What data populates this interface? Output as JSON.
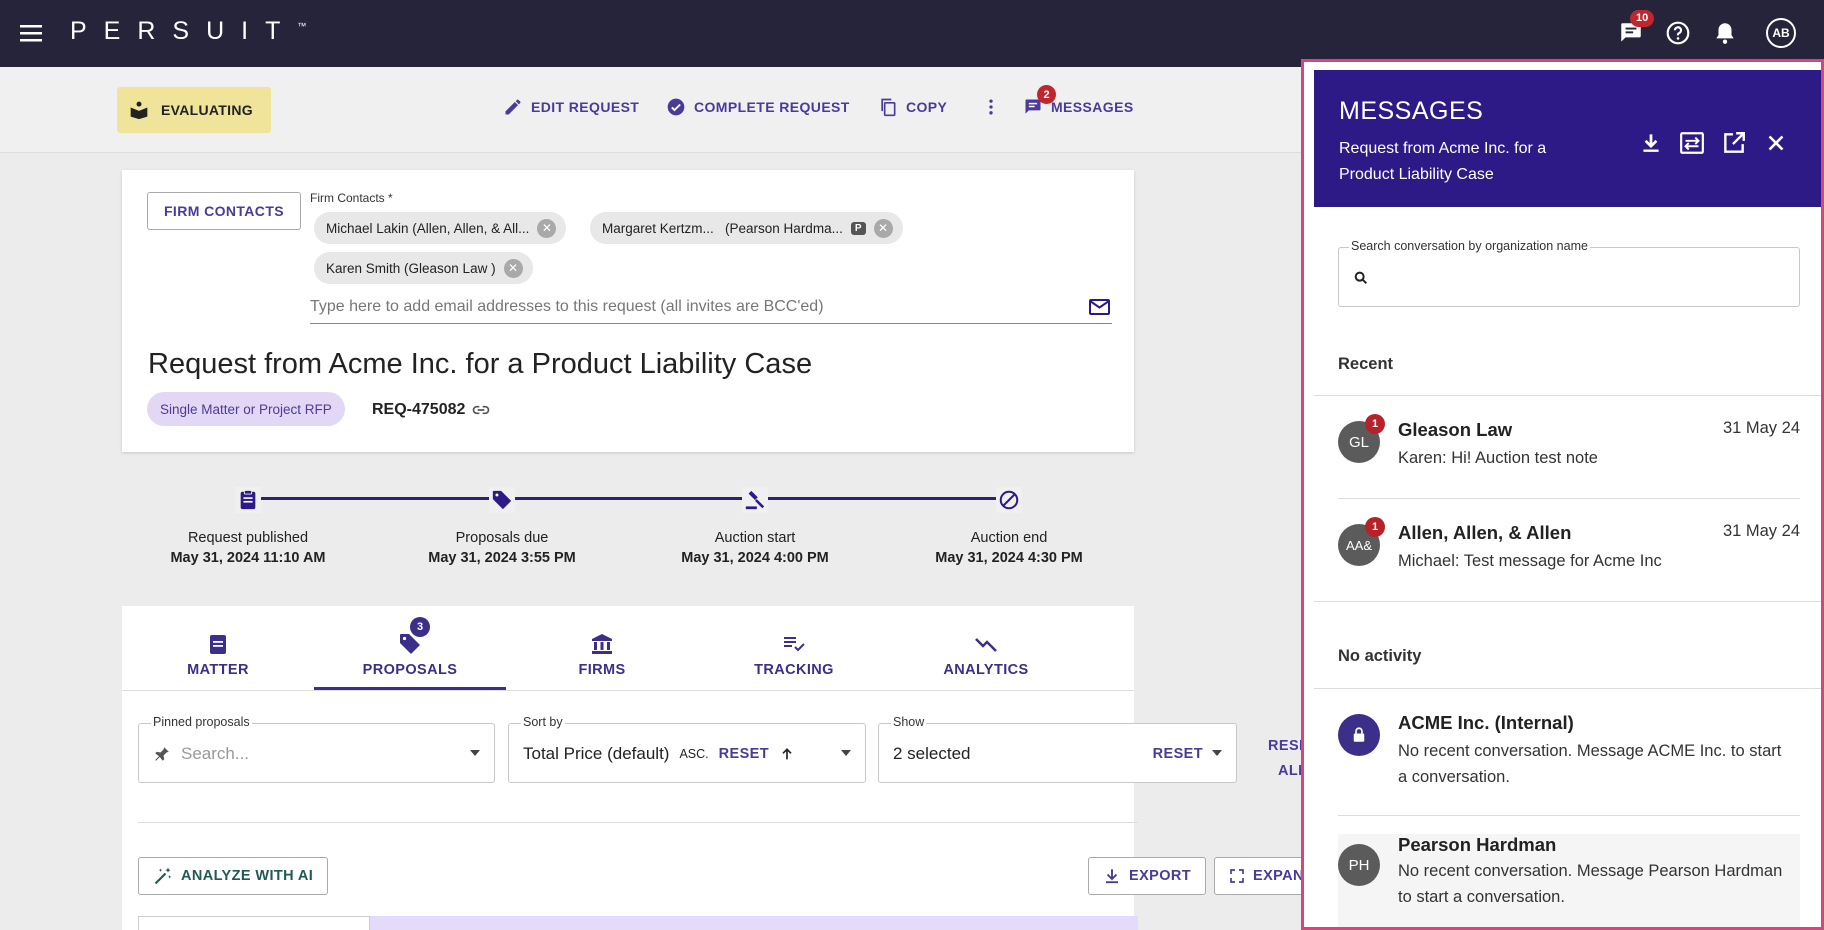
{
  "topbar": {
    "logo": "PERSUIT",
    "logo_tm": "™",
    "messages_badge": "10",
    "avatar": "AB"
  },
  "actionbar": {
    "status": "EVALUATING",
    "edit_request": "EDIT REQUEST",
    "complete_request": "COMPLETE REQUEST",
    "copy": "COPY",
    "messages": "MESSAGES",
    "messages_badge": "2"
  },
  "request_card": {
    "firm_contacts_button": "FIRM CONTACTS",
    "firm_contacts_label": "Firm Contacts *",
    "contacts": [
      {
        "label": "Michael Lakin (Allen, Allen, & All..."
      },
      {
        "label": "Margaret Kertzm...   (Pearson Hardma...",
        "tag": "P"
      },
      {
        "label": "Karen Smith (Gleason Law )"
      }
    ],
    "email_placeholder": "Type here to add email addresses to this request (all invites are BCC'ed)",
    "title": "Request from Acme Inc. for a Product Liability Case",
    "type_chip": "Single Matter or Project RFP",
    "request_id": "REQ-475082"
  },
  "timeline": [
    {
      "label": "Request published",
      "date": "May 31, 2024 11:10 AM"
    },
    {
      "label": "Proposals due",
      "date": "May 31, 2024 3:55 PM"
    },
    {
      "label": "Auction start",
      "date": "May 31, 2024 4:00 PM"
    },
    {
      "label": "Auction end",
      "date": "May 31, 2024 4:30 PM"
    }
  ],
  "tabs": {
    "items": [
      {
        "label": "MATTER",
        "icon": "clipboard-icon"
      },
      {
        "label": "PROPOSALS",
        "icon": "tag-icon",
        "badge": "3"
      },
      {
        "label": "FIRMS",
        "icon": "bank-icon"
      },
      {
        "label": "TRACKING",
        "icon": "checklist-icon"
      },
      {
        "label": "ANALYTICS",
        "icon": "trend-icon"
      }
    ],
    "active": "PROPOSALS"
  },
  "filters": {
    "pinned_label": "Pinned proposals",
    "pinned_placeholder": "Search...",
    "sort_label": "Sort by",
    "sort_value": "Total Price (default)",
    "sort_dir": "ASC.",
    "sort_reset": "RESET",
    "show_label": "Show",
    "show_value": "2 selected",
    "show_reset": "RESET",
    "reset_all_1": "RESET",
    "reset_all_2": "ALL"
  },
  "buttons": {
    "analyze": "ANALYZE WITH AI",
    "export": "EXPORT",
    "expand": "EXPAND"
  },
  "messages_panel": {
    "title": "MESSAGES",
    "subtitle": "Request from Acme Inc. for a Product Liability Case",
    "search_label": "Search conversation by organization name",
    "recent_title": "Recent",
    "no_activity_title": "No activity",
    "recent": [
      {
        "initials": "GL",
        "badge": "1",
        "name": "Gleason Law",
        "date": "31 May 24",
        "preview": "Karen: Hi! Auction test note"
      },
      {
        "initials": "AA&",
        "badge": "1",
        "name": "Allen, Allen, & Allen",
        "date": "31 May 24",
        "preview": "Michael: Test message for Acme Inc"
      }
    ],
    "inactive": [
      {
        "initials": "",
        "icon": "lock-icon",
        "name": "ACME Inc. (Internal)",
        "preview": "No recent conversation. Message ACME Inc. to start a conversation."
      },
      {
        "initials": "PH",
        "name": "Pearson Hardman",
        "preview": "No recent conversation. Message Pearson Hardman to start a conversation."
      }
    ]
  },
  "colors": {
    "topbar": "#25243a",
    "accent": "#4a3a9a",
    "panel_header": "#2e1a86",
    "status_chip": "#efe49a",
    "badge_red": "#c0262d",
    "panel_border": "#d6457b"
  }
}
